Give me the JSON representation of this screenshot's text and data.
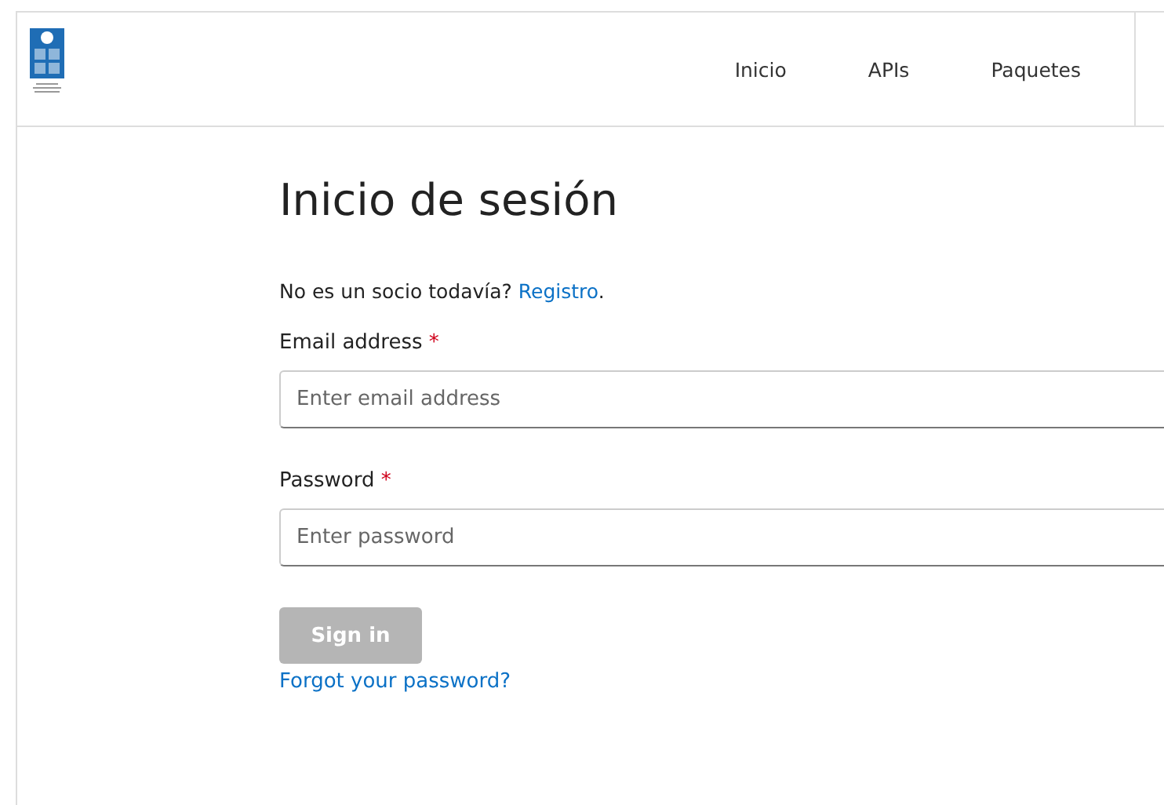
{
  "header": {
    "nav": [
      {
        "label": "Inicio"
      },
      {
        "label": "APIs"
      },
      {
        "label": "Paquetes"
      }
    ]
  },
  "title": "Inicio de sesión",
  "signup": {
    "text": "No es un socio todavía?",
    "link": "Registro",
    "after": "."
  },
  "fields": [
    {
      "label": "Email address",
      "required_mark": "*",
      "placeholder": "Enter email address"
    },
    {
      "label": "Password",
      "required_mark": "*",
      "placeholder": "Enter password"
    }
  ],
  "submit": {
    "label": "Sign in",
    "disabled": true
  },
  "forgot": "Forgot your password?"
}
